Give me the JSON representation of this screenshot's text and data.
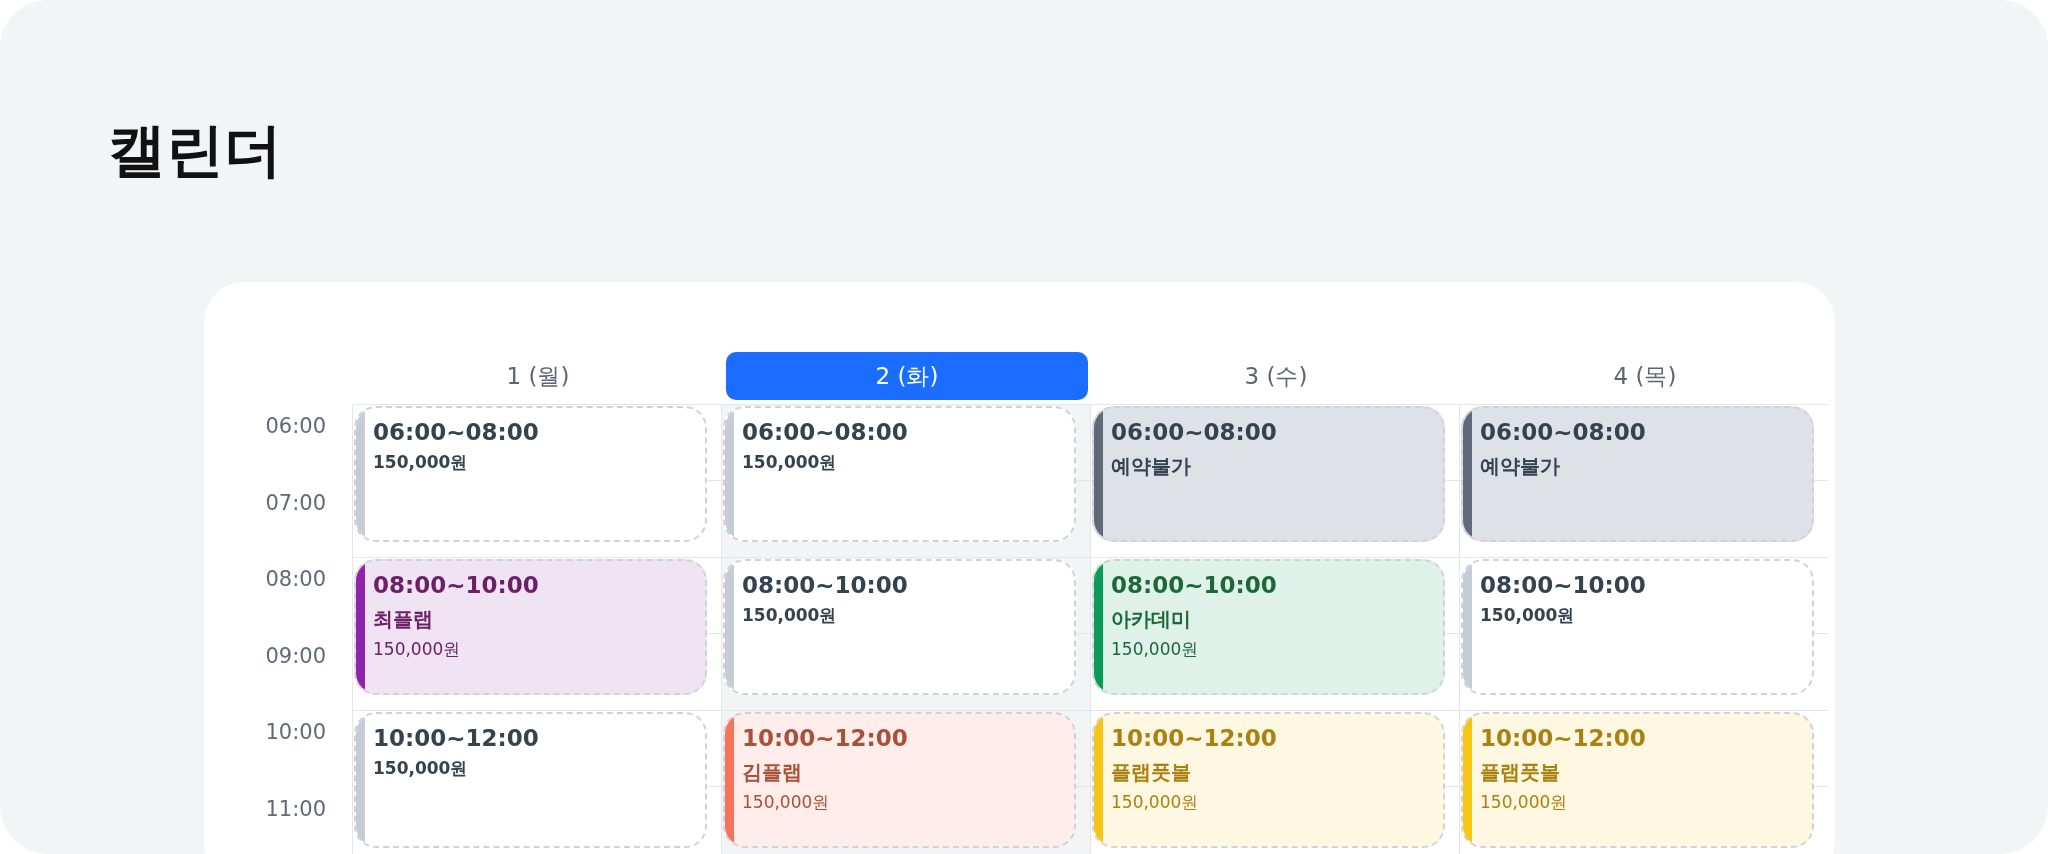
{
  "title": "캘린더",
  "times": [
    "06:00",
    "07:00",
    "08:00",
    "09:00",
    "10:00",
    "11:00"
  ],
  "days": [
    {
      "label": "1 (월)",
      "selected": false,
      "events": [
        {
          "kind": "open",
          "time": "06:00~08:00",
          "price": "150,000원"
        },
        {
          "kind": "booked",
          "time": "08:00~10:00",
          "name": "최플랩",
          "price": "150,000원",
          "color": "#8e24aa"
        },
        {
          "kind": "open",
          "time": "10:00~12:00",
          "price": "150,000원"
        }
      ]
    },
    {
      "label": "2 (화)",
      "selected": true,
      "events": [
        {
          "kind": "open",
          "time": "06:00~08:00",
          "price": "150,000원"
        },
        {
          "kind": "open",
          "time": "08:00~10:00",
          "price": "150,000원"
        },
        {
          "kind": "booked",
          "time": "10:00~12:00",
          "name": "김플랩",
          "price": "150,000원",
          "color": "#f4735a"
        }
      ]
    },
    {
      "label": "3 (수)",
      "selected": false,
      "events": [
        {
          "kind": "blocked",
          "time": "06:00~08:00",
          "name": "예약불가"
        },
        {
          "kind": "booked",
          "time": "08:00~10:00",
          "name": "아카데미",
          "price": "150,000원",
          "color": "#0a9b5a"
        },
        {
          "kind": "booked",
          "time": "10:00~12:00",
          "name": "플랩풋볼",
          "price": "150,000원",
          "color": "#f5c518"
        }
      ]
    },
    {
      "label": "4 (목)",
      "selected": false,
      "events": [
        {
          "kind": "blocked",
          "time": "06:00~08:00",
          "name": "예약불가"
        },
        {
          "kind": "open",
          "time": "08:00~10:00",
          "price": "150,000원"
        },
        {
          "kind": "booked",
          "time": "10:00~12:00",
          "name": "플랩풋볼",
          "price": "150,000원",
          "color": "#f5c518"
        }
      ]
    }
  ]
}
